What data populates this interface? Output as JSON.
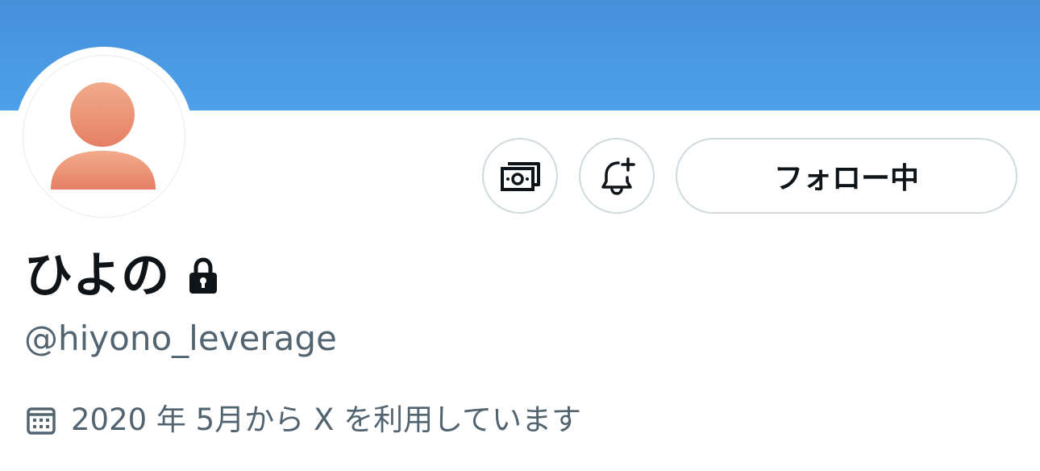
{
  "profile": {
    "display_name": "ひよの",
    "handle": "@hiyono_leverage",
    "joined": "2020 年 5月から X を利用しています",
    "protected": true
  },
  "actions": {
    "tip_icon": "tip-jar-icon",
    "notify_icon": "bell-plus-icon",
    "follow_label": "フォロー中"
  },
  "colors": {
    "banner": "#4a98e4",
    "text_primary": "#0f1419",
    "text_secondary": "#536471",
    "button_border": "#cfd9de",
    "avatar_placeholder": "#ec8a6a"
  }
}
